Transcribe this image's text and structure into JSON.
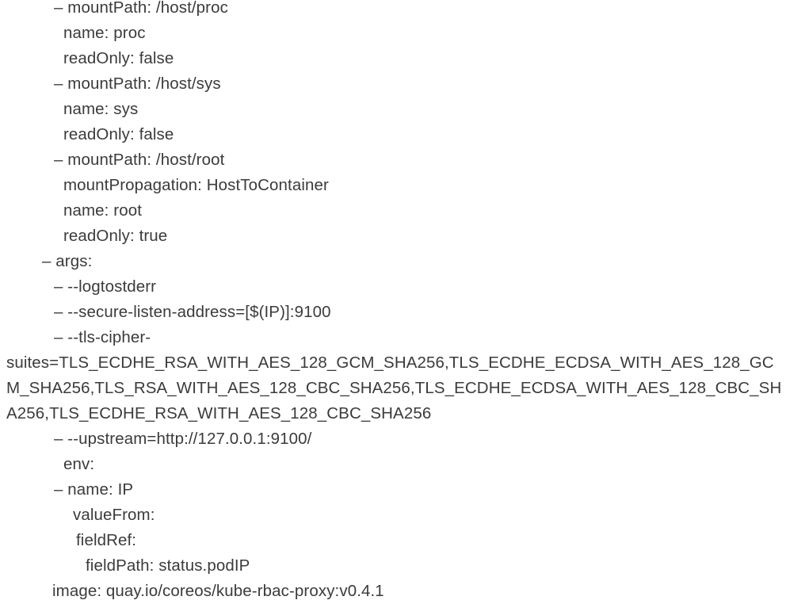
{
  "document": {
    "kind": "yaml-fragment",
    "background_color": "#ffffff",
    "text_color": "#3b3b3b",
    "lines": [
      {
        "indent": "i-seq2",
        "dash": true,
        "text": "mountPath: /host/proc"
      },
      {
        "indent": "i-map2",
        "dash": false,
        "text": "name: proc"
      },
      {
        "indent": "i-map2",
        "dash": false,
        "text": "readOnly: false"
      },
      {
        "indent": "i-seq2",
        "dash": true,
        "text": "mountPath: /host/sys"
      },
      {
        "indent": "i-map2",
        "dash": false,
        "text": "name: sys"
      },
      {
        "indent": "i-map2",
        "dash": false,
        "text": "readOnly: false"
      },
      {
        "indent": "i-seq2",
        "dash": true,
        "text": "mountPath: /host/root"
      },
      {
        "indent": "i-map2",
        "dash": false,
        "text": "mountPropagation: HostToContainer"
      },
      {
        "indent": "i-map2",
        "dash": false,
        "text": "name: root"
      },
      {
        "indent": "i-map2",
        "dash": false,
        "text": "readOnly: true"
      },
      {
        "indent": "i-seq1",
        "dash": true,
        "text": "args:"
      },
      {
        "indent": "i-seq2",
        "dash": true,
        "text": "--logtostderr"
      },
      {
        "indent": "i-seq2",
        "dash": true,
        "text": "--secure-listen-address=[$(IP)]:9100"
      },
      {
        "indent": "i-seq2",
        "dash": true,
        "text": "--tls-cipher-suites=TLS_ECDHE_RSA_WITH_AES_128_GCM_SHA256,TLS_ECDHE_ECDSA_WITH_AES_128_GCM_SHA256,TLS_RSA_WITH_AES_128_CBC_SHA256,TLS_ECDHE_ECDSA_WITH_AES_128_CBC_SHA256,TLS_ECDHE_RSA_WITH_AES_128_CBC_SHA256"
      },
      {
        "indent": "i-seq2",
        "dash": true,
        "text": "--upstream=http://127.0.0.1:9100/"
      },
      {
        "indent": "i-map2",
        "dash": false,
        "text": "env:"
      },
      {
        "indent": "i-seq2",
        "dash": true,
        "text": "name: IP"
      },
      {
        "indent": "i-map3",
        "dash": false,
        "text": "valueFrom:"
      },
      {
        "indent": "i-map4",
        "dash": false,
        "text": "fieldRef:"
      },
      {
        "indent": "i-map5",
        "dash": false,
        "text": "fieldPath: status.podIP"
      },
      {
        "indent": "i-map1",
        "dash": false,
        "text": "image: quay.io/coreos/kube-rbac-proxy:v0.4.1"
      }
    ],
    "dash_glyph": "– "
  }
}
